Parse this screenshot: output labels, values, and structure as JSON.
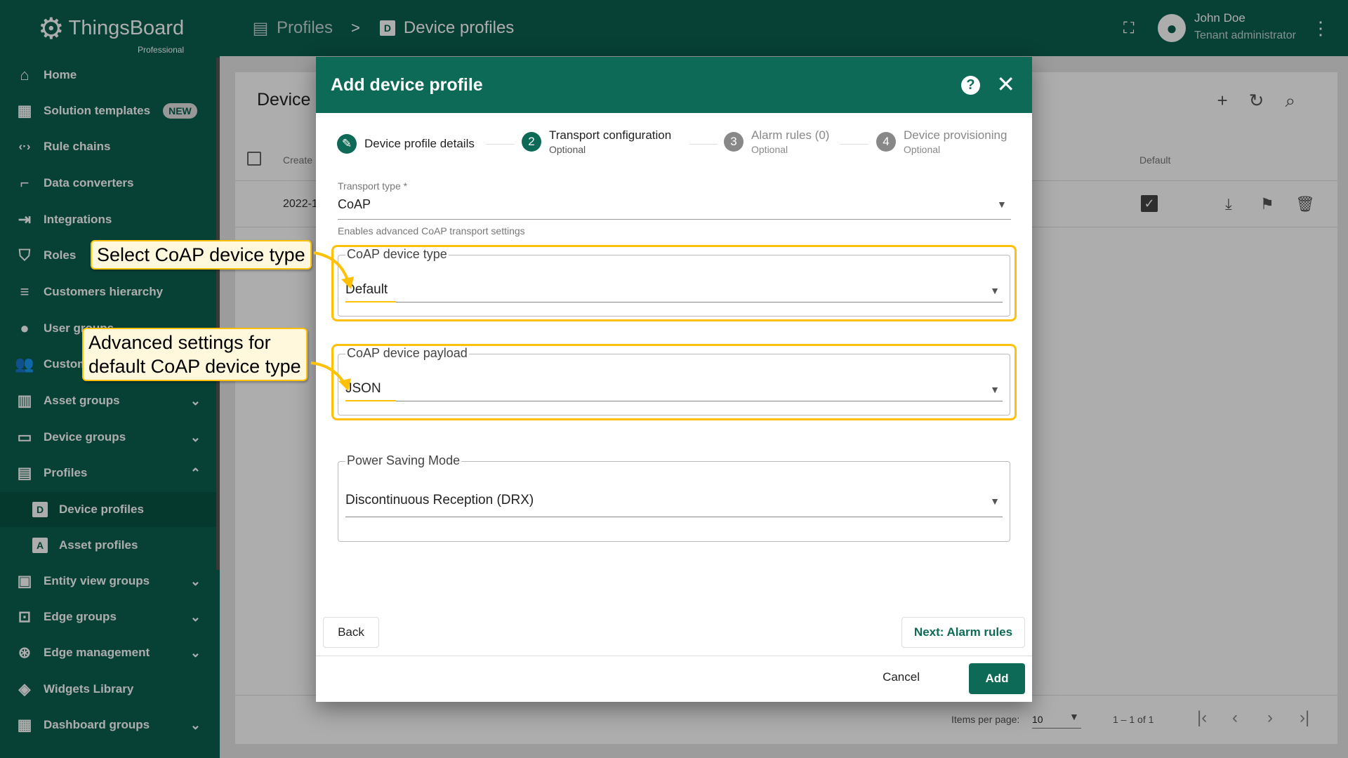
{
  "sidebar": {
    "logo_name": "ThingsBoard",
    "logo_sub": "Professional",
    "items": [
      {
        "label": "Home"
      },
      {
        "label": "Solution templates",
        "badge": "NEW"
      },
      {
        "label": "Rule chains"
      },
      {
        "label": "Data converters"
      },
      {
        "label": "Integrations"
      },
      {
        "label": "Roles"
      },
      {
        "label": "Customers hierarchy"
      },
      {
        "label": "User groups"
      },
      {
        "label": "Customer groups"
      },
      {
        "label": "Asset groups"
      },
      {
        "label": "Device groups"
      },
      {
        "label": "Profiles"
      },
      {
        "label": "Device profiles",
        "icon_letter": "D"
      },
      {
        "label": "Asset profiles",
        "icon_letter": "A"
      },
      {
        "label": "Entity view groups"
      },
      {
        "label": "Edge groups"
      },
      {
        "label": "Edge management"
      },
      {
        "label": "Widgets Library"
      },
      {
        "label": "Dashboard groups"
      }
    ]
  },
  "topbar": {
    "crumb_1": "Profiles",
    "crumb_sep": ">",
    "crumb_2_letter": "D",
    "crumb_2": "Device profiles",
    "user_name": "John Doe",
    "user_role": "Tenant administrator"
  },
  "page": {
    "title": "Device",
    "col_created": "Create",
    "col_default": "Default",
    "row_date": "2022-1",
    "items_per_page_label": "Items per page:",
    "items_per_page_value": "10",
    "range": "1 – 1 of 1"
  },
  "dialog": {
    "title": "Add device profile",
    "steps": [
      {
        "num": "✎",
        "label": "Device profile details",
        "optional": ""
      },
      {
        "num": "2",
        "label": "Transport configuration",
        "optional": "Optional"
      },
      {
        "num": "3",
        "label": "Alarm rules (0)",
        "optional": "Optional"
      },
      {
        "num": "4",
        "label": "Device provisioning",
        "optional": "Optional"
      }
    ],
    "transport_type_label": "Transport type *",
    "transport_type_value": "CoAP",
    "transport_hint": "Enables advanced CoAP transport settings",
    "coap_device_type_label": "CoAP device type",
    "coap_device_type_value": "Default",
    "coap_payload_label": "CoAP device payload",
    "coap_payload_value": "JSON",
    "power_saving_label": "Power Saving Mode",
    "power_saving_value": "Discontinuous Reception (DRX)",
    "back_label": "Back",
    "next_label": "Next: Alarm rules",
    "cancel_label": "Cancel",
    "add_label": "Add"
  },
  "callouts": {
    "one": "Select CoAP device type",
    "two_line1": "Advanced settings for",
    "two_line2": "default CoAP device type"
  },
  "colors": {
    "brand": "#0d6a56",
    "highlight": "#ffc107"
  }
}
